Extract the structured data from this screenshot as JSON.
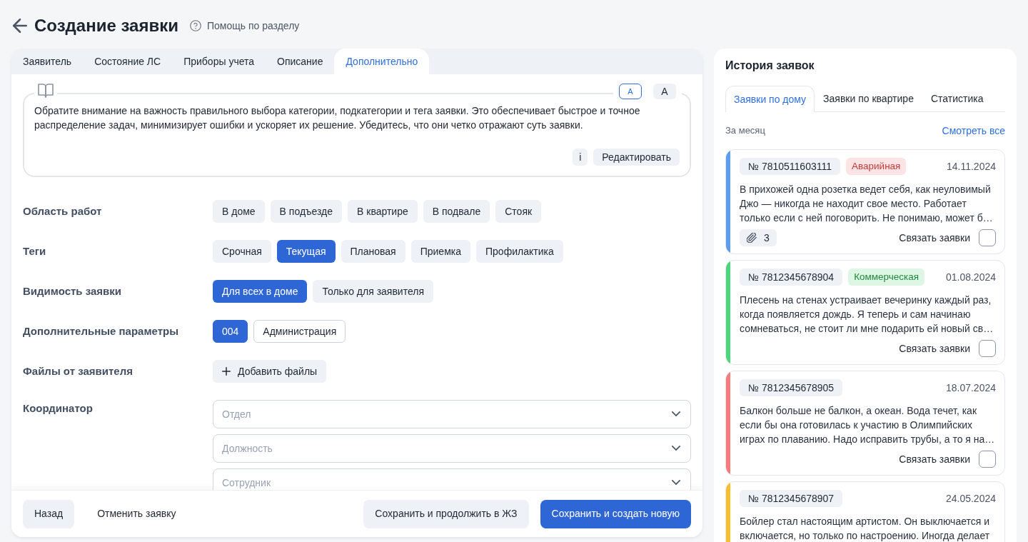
{
  "header": {
    "title": "Создание заявки",
    "help_link": "Помощь по разделу"
  },
  "tabs": [
    {
      "label": "Заявитель",
      "selected": false
    },
    {
      "label": "Состояние ЛС",
      "selected": false
    },
    {
      "label": "Приборы учета",
      "selected": false
    },
    {
      "label": "Описание",
      "selected": false
    },
    {
      "label": "Дополнительно",
      "selected": true
    }
  ],
  "note": {
    "text": "Обратите внимание на важность правильного выбора категории, подкатегории и тега заявки. Это обеспечивает быстрое и точное распределение задач, минимизирует ошибки и ускоряет их решение. Убедитесь, что они четко отражают суть заявки.",
    "font_sizes": [
      {
        "label": "A",
        "kind": "small",
        "selected": true
      },
      {
        "label": "A",
        "kind": "large",
        "selected": false
      }
    ],
    "info_button": "i",
    "edit_button": "Редактировать"
  },
  "fields": [
    {
      "label": "Область работ",
      "kind": "chips",
      "options": [
        {
          "label": "В доме",
          "selected": false
        },
        {
          "label": "В подъезде",
          "selected": false
        },
        {
          "label": "В квартире",
          "selected": false
        },
        {
          "label": "В подвале",
          "selected": false
        },
        {
          "label": "Стояк",
          "selected": false
        }
      ]
    },
    {
      "label": "Теги",
      "kind": "chips",
      "options": [
        {
          "label": "Срочная",
          "selected": false
        },
        {
          "label": "Текущая",
          "selected": true
        },
        {
          "label": "Плановая",
          "selected": false
        },
        {
          "label": "Приемка",
          "selected": false
        },
        {
          "label": "Профилактика",
          "selected": false
        }
      ]
    },
    {
      "label": "Видимость заявки",
      "kind": "chips",
      "options": [
        {
          "label": "Для всех в доме",
          "selected": true
        },
        {
          "label": "Только для заявителя",
          "selected": false
        }
      ]
    },
    {
      "label": "Дополнительные параметры",
      "kind": "outlined",
      "options": [
        {
          "label": "004",
          "selected": true
        },
        {
          "label": "Администрация",
          "selected": false
        }
      ]
    },
    {
      "label": "Файлы от заявителя",
      "kind": "upload",
      "button": "Добавить файлы"
    },
    {
      "label": "Координатор",
      "kind": "selects",
      "selects": [
        {
          "placeholder": "Отдел"
        },
        {
          "placeholder": "Должность"
        },
        {
          "placeholder": "Сотрудник"
        }
      ]
    }
  ],
  "footer": {
    "left": [
      {
        "label": "Назад",
        "kind": "secondary"
      },
      {
        "label": "Отменить заявку",
        "kind": "text"
      }
    ],
    "right": [
      {
        "label": "Сохранить и продолжить в ЖЗ",
        "kind": "secondary"
      },
      {
        "label": "Сохранить и создать новую",
        "kind": "primary"
      }
    ]
  },
  "history": {
    "title": "История заявок",
    "tabs": [
      {
        "label": "Заявки по дому",
        "selected": true
      },
      {
        "label": "Заявки по квартире",
        "selected": false
      },
      {
        "label": "Статистика",
        "selected": false
      }
    ],
    "period": "За месяц",
    "view_all": "Смотреть все",
    "requests": [
      {
        "number": "№ 7810511603111",
        "badge": {
          "label": "Аварийная",
          "kind": "danger"
        },
        "date": "14.11.2024",
        "text": "В прихожей одна розетка ведет себя, как неуловимый Джо — никогда не находит свое место. Работает только если с ней поговорить. Не понимаю, может б…",
        "attachments": "3",
        "link_label": "Связать заявки",
        "linked": false,
        "color": "#5b9cf5"
      },
      {
        "number": "№ 7812345678904",
        "badge": {
          "label": "Коммерческая",
          "kind": "success"
        },
        "date": "01.08.2024",
        "text": "Плесень на стенах устраивает вечеринку каждый раз, когда появляется дождь. Я теперь и сам начинаю сомневаться, не стоит ли мне подарить ей новый св…",
        "link_label": "Связать заявки",
        "linked": false,
        "color": "#4ad67a"
      },
      {
        "number": "№ 7812345678905",
        "date": "18.07.2024",
        "text": "Балкон больше не балкон, а океан. Вода течет, как если бы она готовилась к участию в Олимпийских играх по плаванию. Надо исправить трубы, а то я на…",
        "link_label": "Связать заявки",
        "linked": false,
        "color": "#f87b7b"
      },
      {
        "number": "№ 7812345678907",
        "date": "24.05.2024",
        "text": "Бойлер стал настоящим артистом. Он выключается и включается, но только по настроению. Иногда делает",
        "color": "#f8be2c"
      }
    ]
  }
}
